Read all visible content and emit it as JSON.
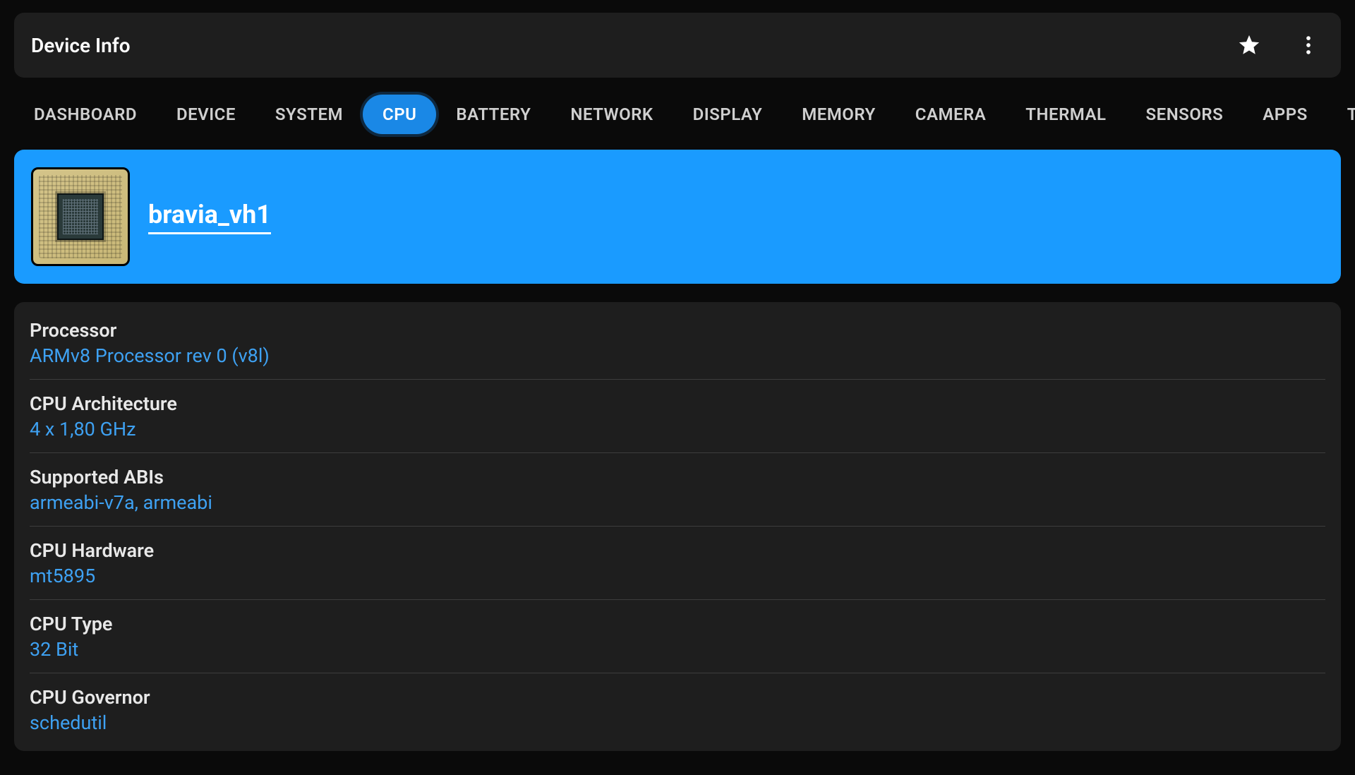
{
  "header": {
    "title": "Device Info"
  },
  "tabs": [
    {
      "label": "DASHBOARD",
      "active": false
    },
    {
      "label": "DEVICE",
      "active": false
    },
    {
      "label": "SYSTEM",
      "active": false
    },
    {
      "label": "CPU",
      "active": true
    },
    {
      "label": "BATTERY",
      "active": false
    },
    {
      "label": "NETWORK",
      "active": false
    },
    {
      "label": "DISPLAY",
      "active": false
    },
    {
      "label": "MEMORY",
      "active": false
    },
    {
      "label": "CAMERA",
      "active": false
    },
    {
      "label": "THERMAL",
      "active": false
    },
    {
      "label": "SENSORS",
      "active": false
    },
    {
      "label": "APPS",
      "active": false
    },
    {
      "label": "T",
      "active": false
    }
  ],
  "cpu_banner": {
    "name": "bravia_vh1"
  },
  "info_rows": [
    {
      "label": "Processor",
      "value": "ARMv8 Processor rev 0 (v8l)"
    },
    {
      "label": "CPU Architecture",
      "value": "4 x 1,80 GHz"
    },
    {
      "label": "Supported ABIs",
      "value": "armeabi-v7a, armeabi"
    },
    {
      "label": "CPU Hardware",
      "value": "mt5895"
    },
    {
      "label": "CPU Type",
      "value": "32 Bit"
    },
    {
      "label": "CPU Governor",
      "value": "schedutil"
    }
  ]
}
